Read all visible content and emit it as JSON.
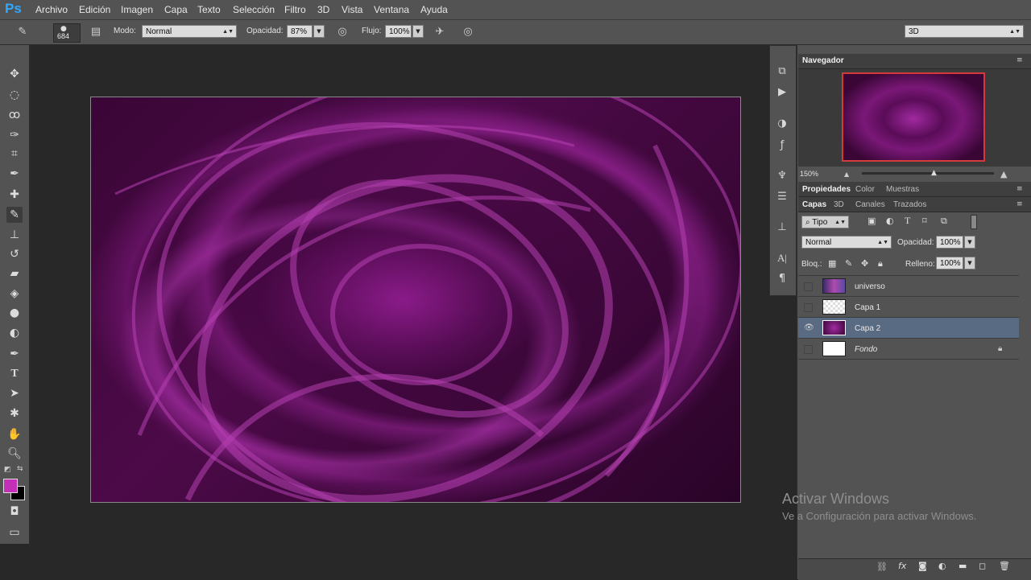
{
  "app": {
    "logo": "Ps"
  },
  "menu": [
    "Archivo",
    "Edición",
    "Imagen",
    "Capa",
    "Texto",
    "Selección",
    "Filtro",
    "3D",
    "Vista",
    "Ventana",
    "Ayuda"
  ],
  "options": {
    "brush_size": "684",
    "mode_label": "Modo:",
    "mode_value": "Normal",
    "opacity_label": "Opacidad:",
    "opacity_value": "87%",
    "flow_label": "Flujo:",
    "flow_value": "100%",
    "workspace": "3D"
  },
  "navigator": {
    "title": "Navegador",
    "zoom": "150%"
  },
  "properties_tabs": [
    "Propiedades",
    "Color",
    "Muestras"
  ],
  "layers_panel": {
    "tabs": [
      "Capas",
      "3D",
      "Canales",
      "Trazados"
    ],
    "filter_type": "Tipo",
    "blend_mode": "Normal",
    "opacity_label": "Opacidad:",
    "opacity_value": "100%",
    "lock_label": "Bloq.:",
    "fill_label": "Relleno:",
    "fill_value": "100%",
    "layers": [
      {
        "name": "universo",
        "visible": false,
        "selected": false
      },
      {
        "name": "Capa 1",
        "visible": false,
        "selected": false
      },
      {
        "name": "Capa 2",
        "visible": true,
        "selected": true
      },
      {
        "name": "Fondo",
        "visible": false,
        "selected": false,
        "locked": true
      }
    ]
  },
  "colors": {
    "foreground": "#c42fb8",
    "background": "#000000",
    "accent": "#31a8ff"
  },
  "watermark": {
    "line1": "Activar Windows",
    "line2": "Ve a Configuración para activar Windows."
  }
}
